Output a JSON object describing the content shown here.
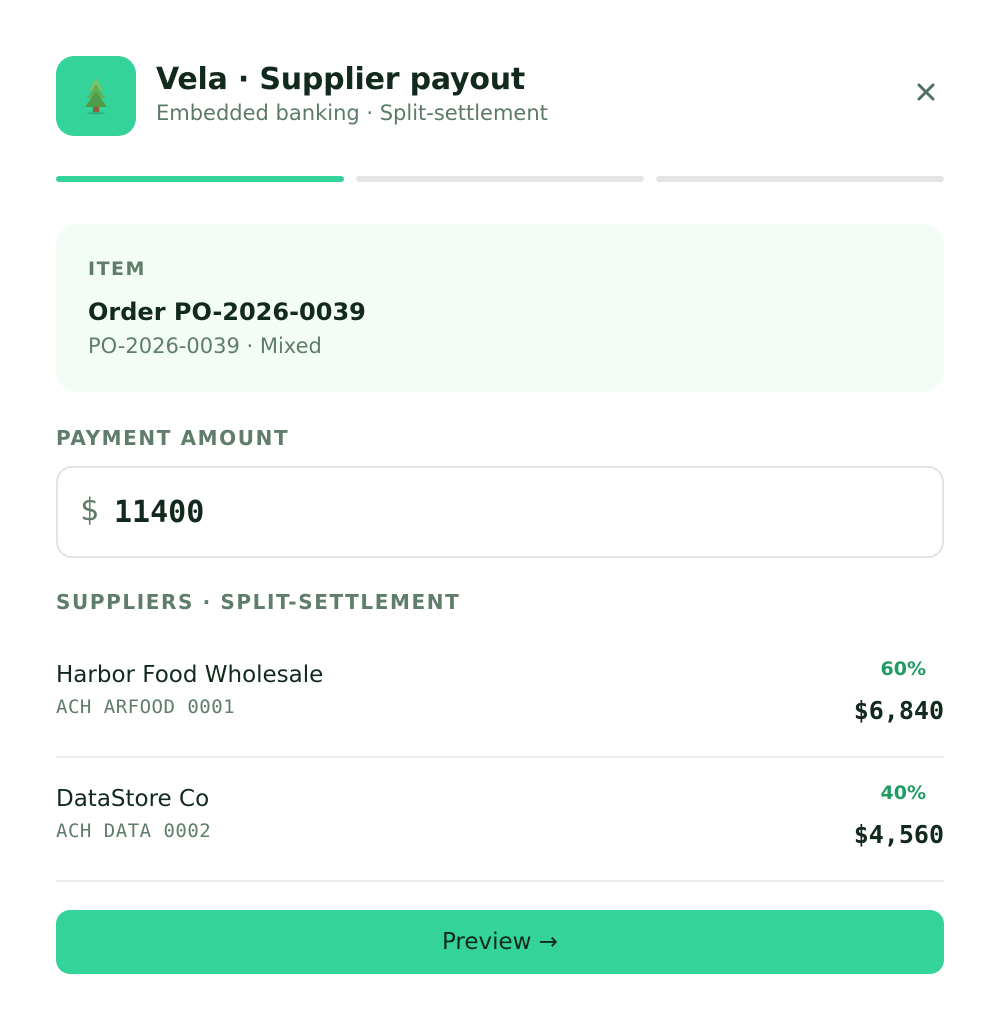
{
  "header": {
    "app_icon": "pine-tree-icon",
    "title": "Vela · Supplier payout",
    "subtitle": "Embedded banking · Split-settlement",
    "close_icon": "close-icon"
  },
  "progress": {
    "steps_total": 3,
    "current_step": 1
  },
  "item": {
    "label": "ITEM",
    "title": "Order PO-2026-0039",
    "detail": "PO-2026-0039 · Mixed"
  },
  "payment": {
    "label": "PAYMENT AMOUNT",
    "currency_symbol": "$",
    "amount_value": "11400"
  },
  "suppliers": {
    "label": "SUPPLIERS · SPLIT-SETTLEMENT",
    "items": [
      {
        "name": "Harbor Food Wholesale",
        "account": "ACH ARFOOD 0001",
        "percent": "60%",
        "amount": "$6,840"
      },
      {
        "name": "DataStore Co",
        "account": "ACH DATA 0002",
        "percent": "40%",
        "amount": "$4,560"
      }
    ]
  },
  "actions": {
    "preview_label": "Preview →"
  },
  "colors": {
    "accent": "#33d399",
    "text_primary": "#12291d",
    "text_muted": "#5f7d6a",
    "percent_green": "#1f9b63",
    "card_bg": "#f3fcf5"
  }
}
